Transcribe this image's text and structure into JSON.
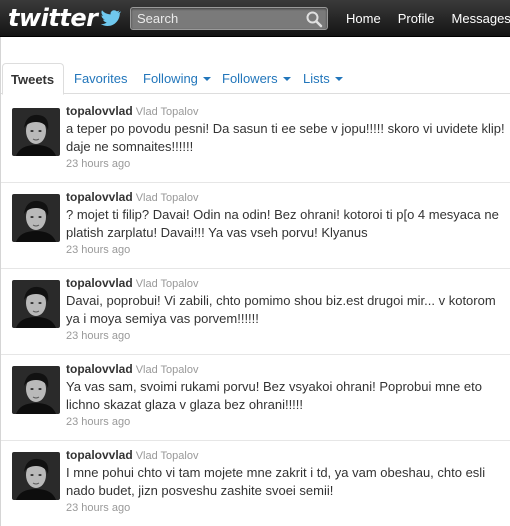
{
  "app": {
    "logo": "twitter"
  },
  "search": {
    "placeholder": "Search"
  },
  "nav": {
    "items": [
      "Home",
      "Profile",
      "Messages"
    ]
  },
  "tabs": {
    "tweets": "Tweets",
    "favorites": "Favorites",
    "following": "Following",
    "followers": "Followers",
    "lists": "Lists"
  },
  "tweets": [
    {
      "screen_name": "topalovvlad",
      "real_name": "Vlad Topalov",
      "text": "a teper po povodu pesni! Da sasun ti ee sebe v jopu!!!!! skoro vi uvidete klip! daje ne somnaites!!!!!!",
      "time": "23 hours ago"
    },
    {
      "screen_name": "topalovvlad",
      "real_name": "Vlad Topalov",
      "text": "? mojet ti filip? Davai! Odin na odin! Bez ohrani! kotoroi ti p[o 4 mesyaca ne platish zarplatu! Davai!!! Ya vas vseh porvu! Klyanus",
      "time": "23 hours ago"
    },
    {
      "screen_name": "topalovvlad",
      "real_name": "Vlad Topalov",
      "text": "Davai, poprobui! Vi zabili, chto pomimo shou biz.est drugoi mir... v kotorom ya i moya semiya vas porvem!!!!!!",
      "time": "23 hours ago"
    },
    {
      "screen_name": "topalovvlad",
      "real_name": "Vlad Topalov",
      "text": "Ya vas sam, svoimi rukami porvu! Bez vsyakoi ohrani! Poprobui mne eto lichno skazat glaza v glaza bez ohrani!!!!!",
      "time": "23 hours ago"
    },
    {
      "screen_name": "topalovvlad",
      "real_name": "Vlad Topalov",
      "text": "I mne pohui chto vi tam mojete mne zakrit i td, ya vam obeshau, chto esli nado budet, jizn posveshu zashite svoei semii!",
      "time": "23 hours ago"
    }
  ]
}
